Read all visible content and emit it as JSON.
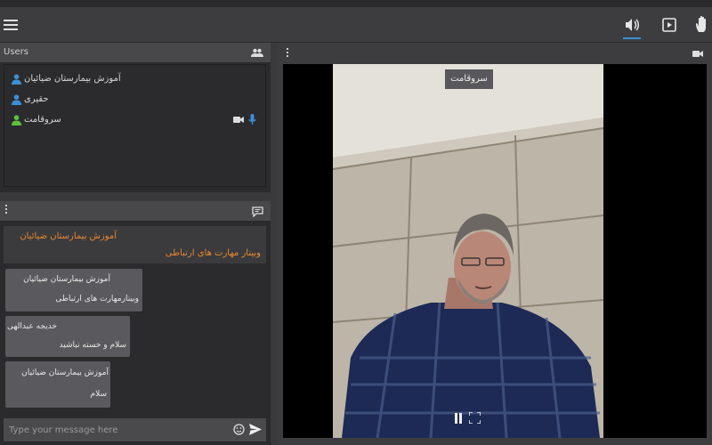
{
  "users_panel": {
    "title": "Users",
    "users": [
      {
        "name": "آموزش بیمارستان ضیائیان",
        "status_color": "#3b8fd8"
      },
      {
        "name": "حقیری",
        "status_color": "#3b8fd8"
      },
      {
        "name": "سروقامت",
        "status_color": "#5cc23a"
      }
    ]
  },
  "chat": {
    "header_line1": "آموزش بیمارستان ضیائیان",
    "header_line2": "وبینار مهارت های ارتباطی",
    "messages": [
      {
        "sender": "آموزش بیمارستان ضیائیان",
        "text": "وبینارمهارت های ارتباطی"
      },
      {
        "sender": "خدیجه عبدالهی",
        "text": "سلام و خسته نباشید"
      },
      {
        "sender": "آموزش بیمارستان ضیائیان",
        "text": "سلام"
      }
    ],
    "input_placeholder": "Type your message here"
  },
  "video": {
    "presenter_name": "سروقامت"
  },
  "colors": {
    "accent": "#3b8fd8",
    "orange": "#e6882e",
    "green": "#5cc23a"
  }
}
